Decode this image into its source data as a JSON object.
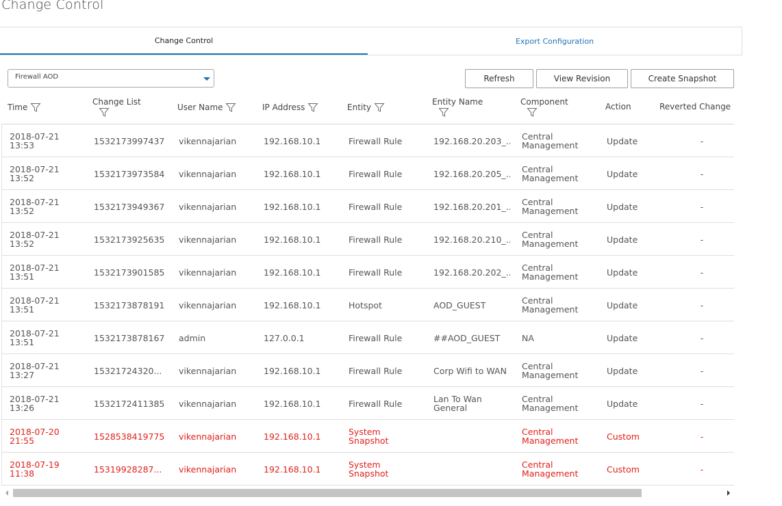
{
  "page": {
    "title": "Change Control"
  },
  "tabs": [
    {
      "label": "Change Control",
      "active": true
    },
    {
      "label": "Export Configuration",
      "active": false
    }
  ],
  "device_select": {
    "value": "Firewall AOD"
  },
  "buttons": {
    "refresh": "Refresh",
    "view_revision": "View Revision",
    "create_snapshot": "Create Snapshot"
  },
  "columns": [
    {
      "label": "Time",
      "filter": true
    },
    {
      "label": "Change List",
      "filter": true
    },
    {
      "label": "User Name",
      "filter": true
    },
    {
      "label": "IP Address",
      "filter": true
    },
    {
      "label": "Entity",
      "filter": true
    },
    {
      "label": "Entity Name",
      "filter": true
    },
    {
      "label": "Component",
      "filter": true
    },
    {
      "label": "Action",
      "filter": false
    },
    {
      "label": "Reverted Change L",
      "filter": false
    }
  ],
  "rows": [
    {
      "date": "2018-07-21",
      "time": "13:53",
      "change_list": "1532173997437",
      "user": "vikennajarian",
      "ip": "192.168.10.1",
      "entity": [
        "Firewall Rule"
      ],
      "entity_name": [
        "192.168.20.203_..."
      ],
      "component": [
        "Central",
        "Management"
      ],
      "action": "Update",
      "reverted": "-",
      "highlight": false
    },
    {
      "date": "2018-07-21",
      "time": "13:52",
      "change_list": "1532173973584",
      "user": "vikennajarian",
      "ip": "192.168.10.1",
      "entity": [
        "Firewall Rule"
      ],
      "entity_name": [
        "192.168.20.205_..."
      ],
      "component": [
        "Central",
        "Management"
      ],
      "action": "Update",
      "reverted": "-",
      "highlight": false
    },
    {
      "date": "2018-07-21",
      "time": "13:52",
      "change_list": "1532173949367",
      "user": "vikennajarian",
      "ip": "192.168.10.1",
      "entity": [
        "Firewall Rule"
      ],
      "entity_name": [
        "192.168.20.201_..."
      ],
      "component": [
        "Central",
        "Management"
      ],
      "action": "Update",
      "reverted": "-",
      "highlight": false
    },
    {
      "date": "2018-07-21",
      "time": "13:52",
      "change_list": "1532173925635",
      "user": "vikennajarian",
      "ip": "192.168.10.1",
      "entity": [
        "Firewall Rule"
      ],
      "entity_name": [
        "192.168.20.210_..."
      ],
      "component": [
        "Central",
        "Management"
      ],
      "action": "Update",
      "reverted": "-",
      "highlight": false
    },
    {
      "date": "2018-07-21",
      "time": "13:51",
      "change_list": "1532173901585",
      "user": "vikennajarian",
      "ip": "192.168.10.1",
      "entity": [
        "Firewall Rule"
      ],
      "entity_name": [
        "192.168.20.202_..."
      ],
      "component": [
        "Central",
        "Management"
      ],
      "action": "Update",
      "reverted": "-",
      "highlight": false
    },
    {
      "date": "2018-07-21",
      "time": "13:51",
      "change_list": "1532173878191",
      "user": "vikennajarian",
      "ip": "192.168.10.1",
      "entity": [
        "Hotspot"
      ],
      "entity_name": [
        "AOD_GUEST"
      ],
      "component": [
        "Central",
        "Management"
      ],
      "action": "Update",
      "reverted": "-",
      "highlight": false
    },
    {
      "date": "2018-07-21",
      "time": "13:51",
      "change_list": "1532173878167",
      "user": "admin",
      "ip": "127.0.0.1",
      "entity": [
        "Firewall Rule"
      ],
      "entity_name": [
        "##AOD_GUEST"
      ],
      "component": [
        "NA"
      ],
      "action": "Update",
      "reverted": "-",
      "highlight": false
    },
    {
      "date": "2018-07-21",
      "time": "13:27",
      "change_list": "15321724320...",
      "user": "vikennajarian",
      "ip": "192.168.10.1",
      "entity": [
        "Firewall Rule"
      ],
      "entity_name": [
        "Corp Wifi to WAN"
      ],
      "component": [
        "Central",
        "Management"
      ],
      "action": "Update",
      "reverted": "-",
      "highlight": false
    },
    {
      "date": "2018-07-21",
      "time": "13:26",
      "change_list": "1532172411385",
      "user": "vikennajarian",
      "ip": "192.168.10.1",
      "entity": [
        "Firewall Rule"
      ],
      "entity_name": [
        "Lan To Wan",
        "General"
      ],
      "component": [
        "Central",
        "Management"
      ],
      "action": "Update",
      "reverted": "-",
      "highlight": false
    },
    {
      "date": "2018-07-20",
      "time": "21:55",
      "change_list": "1528538419775",
      "user": "vikennajarian",
      "ip": "192.168.10.1",
      "entity": [
        "System",
        "Snapshot"
      ],
      "entity_name": [],
      "component": [
        "Central",
        "Management"
      ],
      "action": "Custom",
      "reverted": "-",
      "highlight": true
    },
    {
      "date": "2018-07-19",
      "time": "11:38",
      "change_list": "15319928287...",
      "user": "vikennajarian",
      "ip": "192.168.10.1",
      "entity": [
        "System",
        "Snapshot"
      ],
      "entity_name": [],
      "component": [
        "Central",
        "Management"
      ],
      "action": "Custom",
      "reverted": "-",
      "highlight": true
    }
  ],
  "colors": {
    "accent": "#1f73b7",
    "highlight_text": "#e0201b",
    "border": "#dcdcdc"
  },
  "icons": {
    "filter": "funnel-filter-icon",
    "dropdown": "chevron-down-icon"
  }
}
